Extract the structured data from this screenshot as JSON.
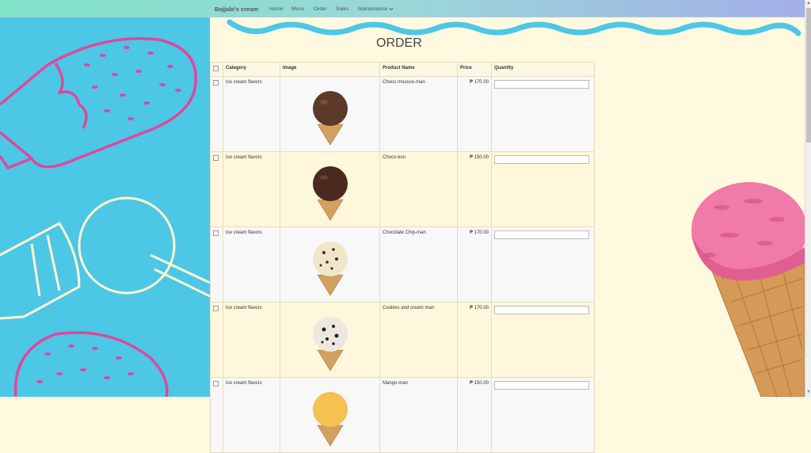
{
  "navbar": {
    "brand": "Bojjabi's cream",
    "links": [
      "Home",
      "Menu",
      "Order",
      "Sales"
    ],
    "maintenance": "Maintenance",
    "maintenance_icon": "chevron-down-icon"
  },
  "page": {
    "title": "ORDER"
  },
  "table": {
    "headers": [
      "Category",
      "Image",
      "Product Name",
      "Price",
      "Quantity"
    ],
    "rows": [
      {
        "category": "Ice cream flavors",
        "product": "Choco mousse-man",
        "price": "₱ 170.00",
        "image": "chocolate-scoop",
        "color": "#5b3a2a"
      },
      {
        "category": "Ice cream flavors",
        "product": "Choco-kun",
        "price": "₱ 150.00",
        "image": "dark-chocolate-scoop",
        "color": "#4a2a1e"
      },
      {
        "category": "Ice cream flavors",
        "product": "Chocolate Chip-man",
        "price": "₱ 170.00",
        "image": "chocolate-chip-scoop",
        "color": "#f0e6c8"
      },
      {
        "category": "Ice cream flavors",
        "product": "Cookies and cream man",
        "price": "₱ 170.00",
        "image": "cookies-cream-scoop",
        "color": "#ece8e0"
      },
      {
        "category": "Ice cream flavors",
        "product": "Mango-man",
        "price": "₱ 150.00",
        "image": "mango-scoop",
        "color": "#f4c152"
      }
    ]
  },
  "colors": {
    "left_bg": "#4cc7e6",
    "wave": "#4cc7e6",
    "pink": "#e0479e",
    "page_bg": "#fff9e0"
  }
}
